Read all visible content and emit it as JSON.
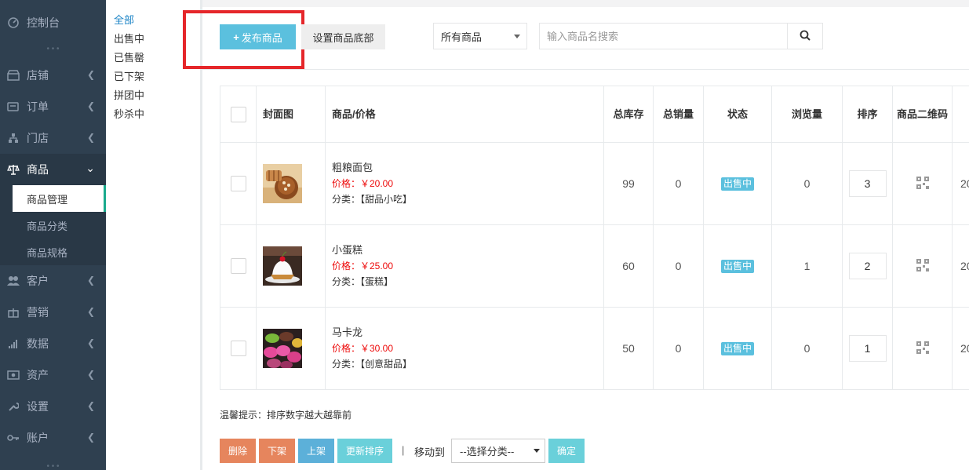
{
  "sidebar": {
    "items": [
      {
        "label": "控制台",
        "icon": "dashboard-icon"
      },
      {
        "label": "店铺",
        "icon": "shop-icon"
      },
      {
        "label": "订单",
        "icon": "order-icon"
      },
      {
        "label": "门店",
        "icon": "store-tree-icon"
      },
      {
        "label": "商品",
        "icon": "scale-icon"
      },
      {
        "label": "客户",
        "icon": "users-icon"
      },
      {
        "label": "营销",
        "icon": "gift-icon"
      },
      {
        "label": "数据",
        "icon": "bar-chart-icon"
      },
      {
        "label": "资产",
        "icon": "money-icon"
      },
      {
        "label": "设置",
        "icon": "wrench-icon"
      },
      {
        "label": "账户",
        "icon": "key-icon"
      }
    ],
    "goods_sub": [
      "商品管理",
      "商品分类",
      "商品规格"
    ]
  },
  "subnav": [
    "全部",
    "出售中",
    "已售罄",
    "已下架",
    "拼团中",
    "秒杀中"
  ],
  "toolbar": {
    "publish_label": "发布商品",
    "set_bottom_label": "设置商品底部",
    "filter_value": "所有商品",
    "search_placeholder": "输入商品名搜索"
  },
  "table": {
    "headers": [
      "封面图",
      "商品/价格",
      "总库存",
      "总销量",
      "状态",
      "浏览量",
      "排序",
      "商品二维码"
    ],
    "rows": [
      {
        "name": "粗粮面包",
        "price": "价格：￥20.00",
        "category": "分类：【甜品小吃】",
        "stock": "99",
        "sales": "0",
        "status": "出售中",
        "views": "0",
        "sort": "3",
        "clip": "20"
      },
      {
        "name": "小蛋糕",
        "price": "价格：￥25.00",
        "category": "分类：【蛋糕】",
        "stock": "60",
        "sales": "0",
        "status": "出售中",
        "views": "1",
        "sort": "2",
        "clip": "20"
      },
      {
        "name": "马卡龙",
        "price": "价格：￥30.00",
        "category": "分类：【创意甜品】",
        "stock": "50",
        "sales": "0",
        "status": "出售中",
        "views": "0",
        "sort": "1",
        "clip": "20"
      }
    ]
  },
  "footer": {
    "tip": "温馨提示：排序数字越大越靠前",
    "delete_label": "删除",
    "offshelf_label": "下架",
    "onshelf_label": "上架",
    "update_sort_label": "更新排序",
    "separator": "|",
    "move_to_label": "移动到",
    "category_select": "--选择分类--",
    "confirm_label": "确定"
  },
  "colors": {
    "sidebar_bg": "#2f4050",
    "accent_blue": "#5bc0de",
    "highlight_red": "#e5262a",
    "price_red": "#ed0a0a"
  }
}
